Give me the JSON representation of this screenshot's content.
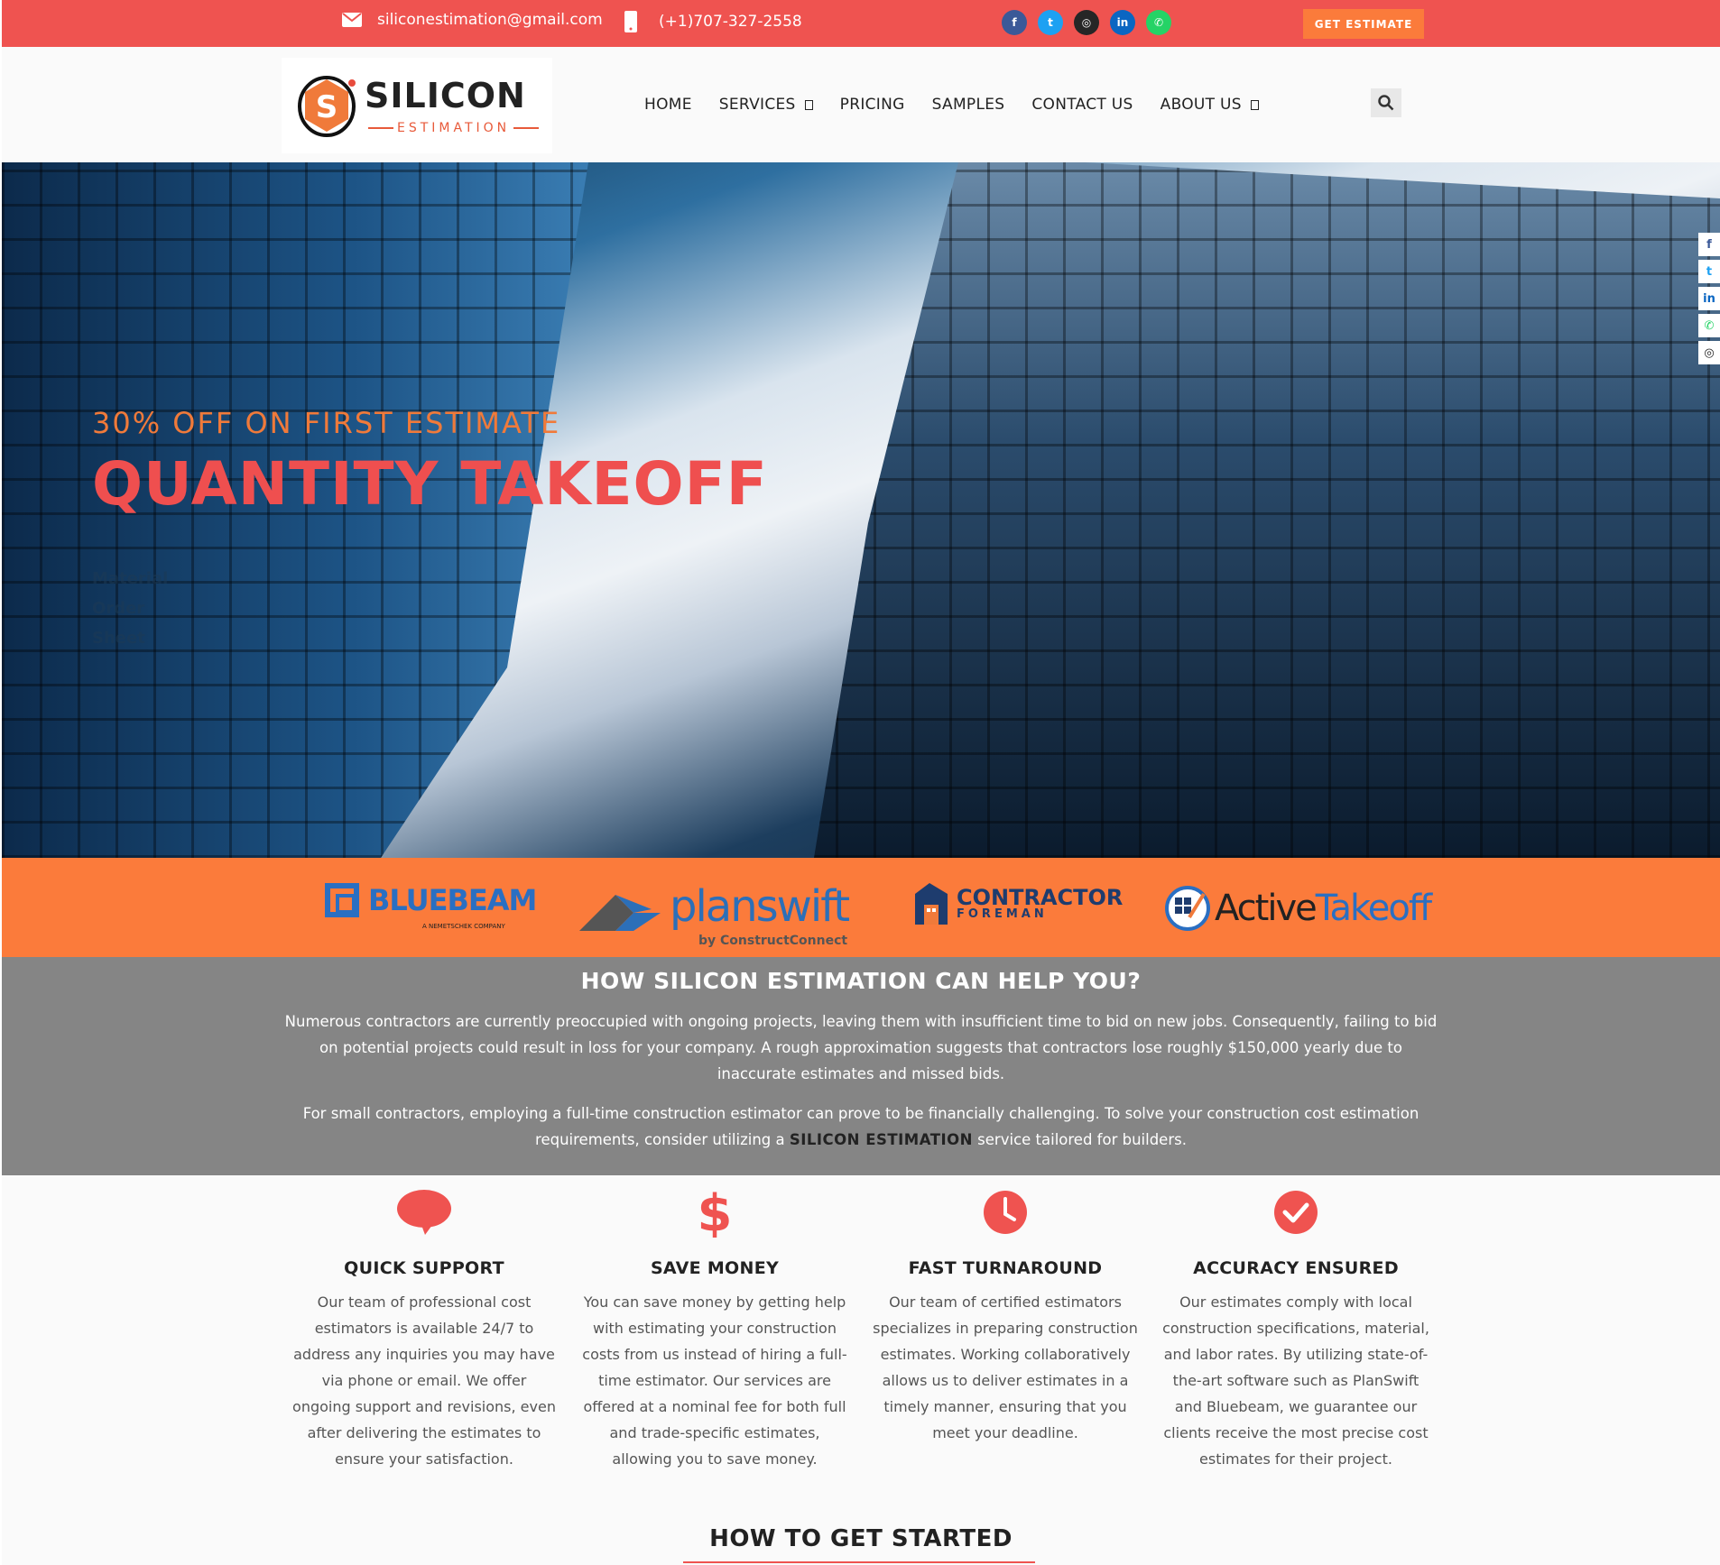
{
  "topbar": {
    "email": "siliconestimation@gmail.com",
    "phone": "(+1)707-327-2558",
    "social": [
      {
        "name": "facebook-icon",
        "glyph": "f",
        "color": "#3b5998"
      },
      {
        "name": "twitter-icon",
        "glyph": "t",
        "color": "#1da1f2"
      },
      {
        "name": "instagram-icon",
        "glyph": "◎",
        "color": "#262626"
      },
      {
        "name": "linkedin-icon",
        "glyph": "in",
        "color": "#0a66c2"
      },
      {
        "name": "whatsapp-icon",
        "glyph": "✆",
        "color": "#25d366"
      }
    ],
    "cta_label": "GET ESTIMATE",
    "background": "#ef5350",
    "cta_color": "#fb7b3b"
  },
  "header": {
    "logo_text": "SILICON",
    "logo_sub": "ESTIMATION",
    "nav": [
      "HOME",
      "SERVICES",
      "PRICING",
      "SAMPLES",
      "CONTACT US",
      "ABOUT US"
    ]
  },
  "hero": {
    "kicker": "30% OFF ON FIRST ESTIMATE",
    "title": "QUANTITY TAKEOFF",
    "sub_lines": [
      "Material",
      "Order",
      "Sheet"
    ],
    "side_icons": [
      "facebook-icon",
      "twitter-icon",
      "linkedin-icon",
      "whatsapp-icon",
      "instagram-icon"
    ]
  },
  "partners": {
    "bluebeam": {
      "name": "BLUEBEAM",
      "tagline": "A NEMETSCHEK COMPANY"
    },
    "planswift": {
      "name": "planswift",
      "tagline": "by ConstructConnect"
    },
    "contractor": {
      "name": "CONTRACTOR",
      "tagline": "FOREMAN"
    },
    "active": {
      "name_a": "Active",
      "name_b": "Takeoff"
    }
  },
  "help": {
    "title": "HOW SILICON ESTIMATION CAN HELP YOU?",
    "p1": "Numerous contractors are currently preoccupied with ongoing projects, leaving them with insufficient time to bid on new jobs. Consequently, failing to bid on potential projects could result in loss for your company. A rough approximation suggests that contractors lose roughly $150,000 yearly due to inaccurate estimates and missed bids.",
    "p2_before": "For small contractors, employing a full-time construction estimator can prove to be financially challenging. To solve your construction cost estimation requirements, consider utilizing a ",
    "p2_strong": "SILICON ESTIMATION",
    "p2_after": "  service tailored for builders."
  },
  "features": [
    {
      "title": "QUICK SUPPORT",
      "icon": "chat-bubble-icon",
      "text": "Our team of professional cost estimators is available 24/7 to address any inquiries you may have via phone or email. We offer ongoing support and revisions, even after delivering the estimates to ensure your satisfaction."
    },
    {
      "title": "SAVE MONEY",
      "icon": "dollar-icon",
      "text": "You can save money by getting help with estimating your construction costs from us instead of hiring a full-time estimator. Our services are offered at a nominal fee for both full and trade-specific estimates, allowing you to save money."
    },
    {
      "title": "FAST TURNAROUND",
      "icon": "clock-icon",
      "text": "Our team of certified estimators specializes in preparing construction estimates. Working collaboratively allows us to deliver estimates in a timely manner, ensuring that you meet your deadline."
    },
    {
      "title": "ACCURACY ENSURED",
      "icon": "check-circle-icon",
      "text": "Our estimates comply with local construction specifications, material, and labor rates. By utilizing state-of-the-art software such as PlanSwift and Bluebeam, we guarantee our clients receive the most precise cost estimates for their project."
    }
  ],
  "started_title": "HOW TO GET STARTED",
  "accent": "#ef5350",
  "orange": "#fb7b3b"
}
